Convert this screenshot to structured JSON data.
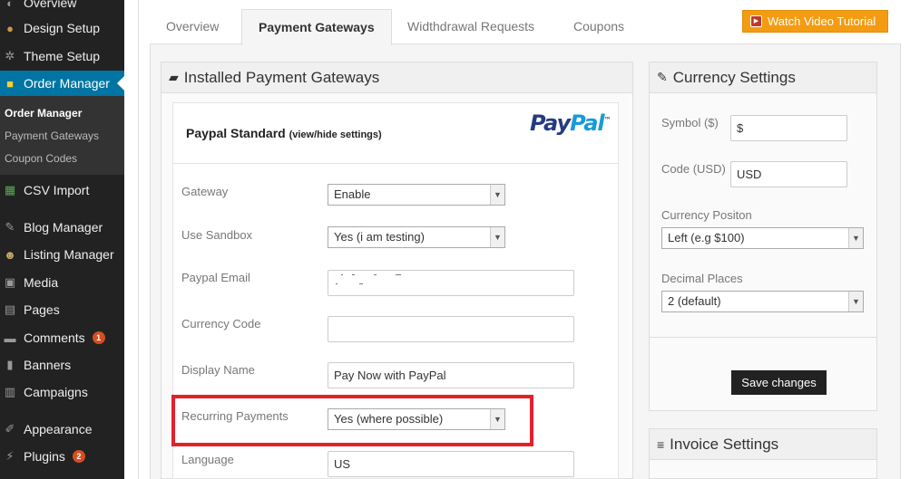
{
  "sidebar": {
    "menu": [
      {
        "label": "Overview",
        "icon": "dashboard-icon"
      },
      {
        "label": "Design Setup",
        "icon": "palette-icon"
      },
      {
        "label": "Theme Setup",
        "icon": "gear-icon"
      },
      {
        "label": "Order Manager",
        "icon": "cart-icon"
      },
      {
        "label": "CSV Import",
        "icon": "csv-icon"
      },
      {
        "label": "Blog Manager",
        "icon": "pin-icon"
      },
      {
        "label": "Listing Manager",
        "icon": "smiley-icon"
      },
      {
        "label": "Media",
        "icon": "media-icon"
      },
      {
        "label": "Pages",
        "icon": "pages-icon"
      },
      {
        "label": "Comments",
        "icon": "comment-icon",
        "badge": "1"
      },
      {
        "label": "Banners",
        "icon": "banner-icon"
      },
      {
        "label": "Campaigns",
        "icon": "campaign-icon"
      },
      {
        "label": "Appearance",
        "icon": "brush-icon"
      },
      {
        "label": "Plugins",
        "icon": "plug-icon",
        "badge": "2"
      }
    ],
    "submenu": [
      "Order Manager",
      "Payment Gateways",
      "Coupon Codes"
    ]
  },
  "tabs": [
    "Overview",
    "Payment Gateways",
    "Widthdrawal Requests",
    "Coupons"
  ],
  "video_button": "Watch Video Tutorial",
  "installed_panel": {
    "title": "Installed Payment Gateways",
    "gateway_title": "Paypal Standard",
    "gateway_toggle": "(view/hide settings)",
    "logo_a": "Pay",
    "logo_b": "Pal",
    "logo_tm": "™",
    "fields": {
      "gateway": {
        "label": "Gateway",
        "value": "Enable"
      },
      "sandbox": {
        "label": "Use Sandbox",
        "value": "Yes (i am testing)"
      },
      "email": {
        "label": "Paypal Email",
        "value": ""
      },
      "currency_code": {
        "label": "Currency Code",
        "value": ""
      },
      "display_name": {
        "label": "Display Name",
        "value": "Pay Now with PayPal"
      },
      "recurring": {
        "label": "Recurring Payments",
        "value": "Yes (where possible)"
      },
      "language": {
        "label": "Language",
        "value": "US"
      }
    }
  },
  "currency_panel": {
    "title": "Currency Settings",
    "symbol": {
      "label": "Symbol ($)",
      "value": "$"
    },
    "code": {
      "label": "Code (USD)",
      "value": "USD"
    },
    "position": {
      "label": "Currency Positon",
      "value": "Left (e.g $100)"
    },
    "decimal": {
      "label": "Decimal Places",
      "value": "2 (default)"
    },
    "save": "Save changes"
  },
  "invoice_panel": {
    "title": "Invoice Settings"
  },
  "colors": {
    "sidebar": "#222222",
    "active": "#0074a2",
    "highlight": "#e2212b",
    "video_button": "#f39c12"
  }
}
